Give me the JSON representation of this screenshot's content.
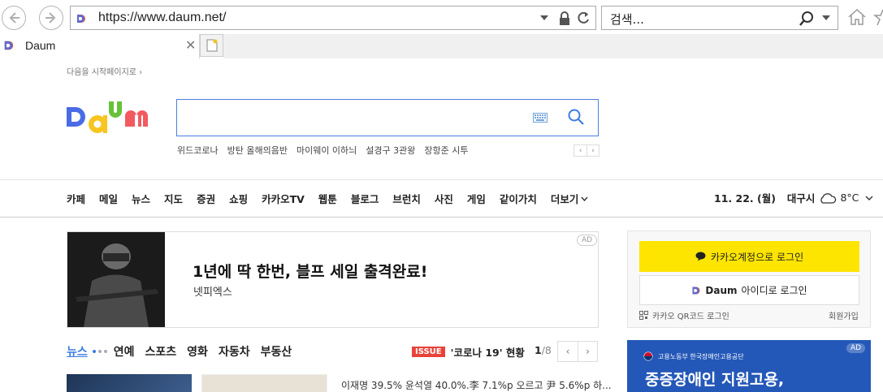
{
  "browser": {
    "url": "https://www.daum.net/",
    "search_placeholder": "검색...",
    "tab_title": "Daum"
  },
  "page": {
    "set_start_page": "다음을 시작페이지로",
    "trending": [
      "위드코로나",
      "방탄 올해의음반",
      "마이웨이 이하늬",
      "설경구 3관왕",
      "장항준 시투"
    ],
    "gnb": [
      "카페",
      "메일",
      "뉴스",
      "지도",
      "증권",
      "쇼핑",
      "카카오TV",
      "웹툰",
      "블로그",
      "브런치",
      "사진",
      "게임",
      "같이가치"
    ],
    "gnb_more": "더보기",
    "date": "11. 22. (월)",
    "city": "대구시",
    "temperature": "8°C",
    "ad": {
      "badge": "AD",
      "title": "1년에 딱 한번, 블프 세일 출격완료!",
      "advertiser": "넷피엑스"
    },
    "news_tabs": [
      "뉴스",
      "연예",
      "스포츠",
      "영화",
      "자동차",
      "부동산"
    ],
    "issue_badge": "ISSUE",
    "issue_text": "'코로나 19' 현황",
    "page_current": "1",
    "page_total": "/8",
    "headline": "이재명 39.5% 윤석열 40.0%.李 7.1%p 오르고 尹 5.6%p 하..."
  },
  "login": {
    "kakao_label": "카카오계정으로 로그인",
    "daum_label": "아이디로 로그인",
    "daum_brand": "Daum",
    "qr_label": "카카오 QR코드 로그인",
    "signup_label": "회원가입"
  },
  "side_ad": {
    "badge": "AD",
    "org": "고용노동부   한국장애인고용공단",
    "title": "중증장애인 지원고용,"
  },
  "colors": {
    "accent_blue": "#3b7de3",
    "kakao_yellow": "#fee500",
    "issue_red": "#e8433a",
    "side_ad_blue": "#2458b8"
  }
}
